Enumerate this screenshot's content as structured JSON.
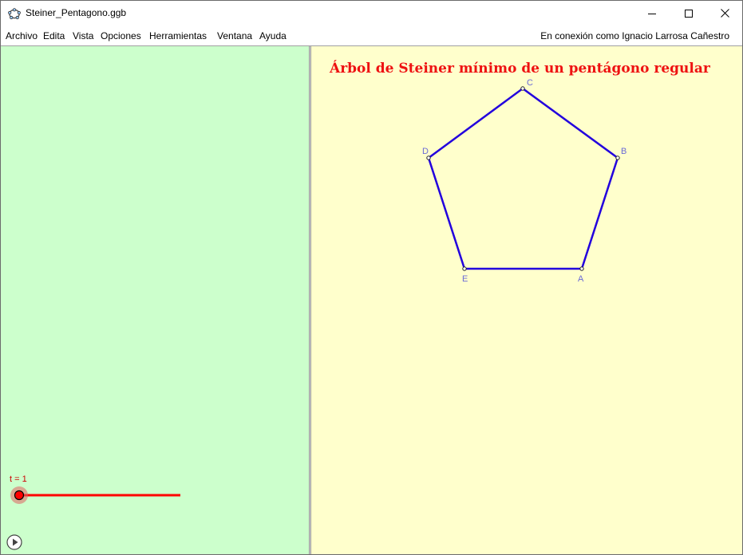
{
  "window": {
    "title": "Steiner_Pentagono.ggb",
    "buttons": [
      "minimize",
      "maximize",
      "close"
    ]
  },
  "menu": {
    "items": [
      "Archivo",
      "Edita",
      "Vista",
      "Opciones",
      "Herramientas",
      "Ventana",
      "Ayuda"
    ],
    "login_status": "En conexión como Ignacio Larrosa Cañestro"
  },
  "algebra_view": {
    "slider": {
      "label": "t = 1",
      "value": 1,
      "min": 0,
      "max": 1,
      "color": "#ff0000"
    },
    "play_icon": "play-icon"
  },
  "graphics_view": {
    "title": "Árbol de Steiner mínimo de un pentágono regular",
    "title_color": "#ee1111",
    "polygon_color": "#2200dd",
    "point_label_color": "#6b6bd6",
    "points": [
      {
        "name": "A"
      },
      {
        "name": "B"
      },
      {
        "name": "C"
      },
      {
        "name": "D"
      },
      {
        "name": "E"
      }
    ]
  },
  "colors": {
    "algebra_bg": "#ccffcc",
    "graphics_bg": "#ffffcc"
  }
}
